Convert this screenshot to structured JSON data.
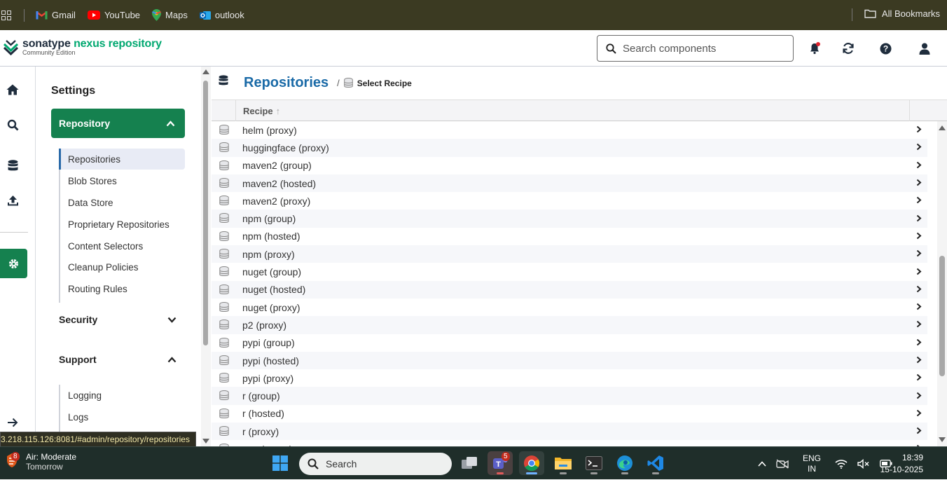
{
  "bookmarks": {
    "items": [
      {
        "label": "Gmail",
        "icon": "gmail-icon"
      },
      {
        "label": "YouTube",
        "icon": "youtube-icon"
      },
      {
        "label": "Maps",
        "icon": "maps-icon"
      },
      {
        "label": "outlook",
        "icon": "outlook-icon"
      }
    ],
    "all_label": "All Bookmarks"
  },
  "header": {
    "logo_word1": "sonatype",
    "logo_word2": "nexus repository",
    "logo_sub": "Community Edition",
    "search_placeholder": "Search components"
  },
  "settings": {
    "title": "Settings",
    "repository_group": "Repository",
    "repository_items": [
      "Repositories",
      "Blob Stores",
      "Data Store",
      "Proprietary Repositories",
      "Content Selectors",
      "Cleanup Policies",
      "Routing Rules"
    ],
    "security_label": "Security",
    "support_label": "Support",
    "support_items": [
      "Logging",
      "Logs"
    ]
  },
  "main": {
    "breadcrumb_title": "Repositories",
    "breadcrumb_sep": "/",
    "breadcrumb_sub": "Select Recipe",
    "column_header": "Recipe",
    "sort_arrow": "↑",
    "recipes": [
      "helm (proxy)",
      "huggingface (proxy)",
      "maven2 (group)",
      "maven2 (hosted)",
      "maven2 (proxy)",
      "npm (group)",
      "npm (hosted)",
      "npm (proxy)",
      "nuget (group)",
      "nuget (hosted)",
      "nuget (proxy)",
      "p2 (proxy)",
      "pypi (group)",
      "pypi (hosted)",
      "pypi (proxy)",
      "r (group)",
      "r (hosted)",
      "r (proxy)",
      "raw (group)"
    ]
  },
  "status_url": "3.218.115.126:8081/#admin/repository/repositories",
  "taskbar": {
    "weather_badge": "8",
    "weather_title": "Air: Moderate",
    "weather_sub": "Tomorrow",
    "search_label": "Search",
    "teams_badge": "5",
    "lang1": "ENG",
    "lang2": "IN",
    "time": "18:39",
    "date": "15-10-2025"
  },
  "colors": {
    "brand_green": "#15814f",
    "link_blue": "#1a6aa7",
    "bookmarks_bg": "#3b3a22",
    "taskbar_bg": "#1f2e2a"
  }
}
